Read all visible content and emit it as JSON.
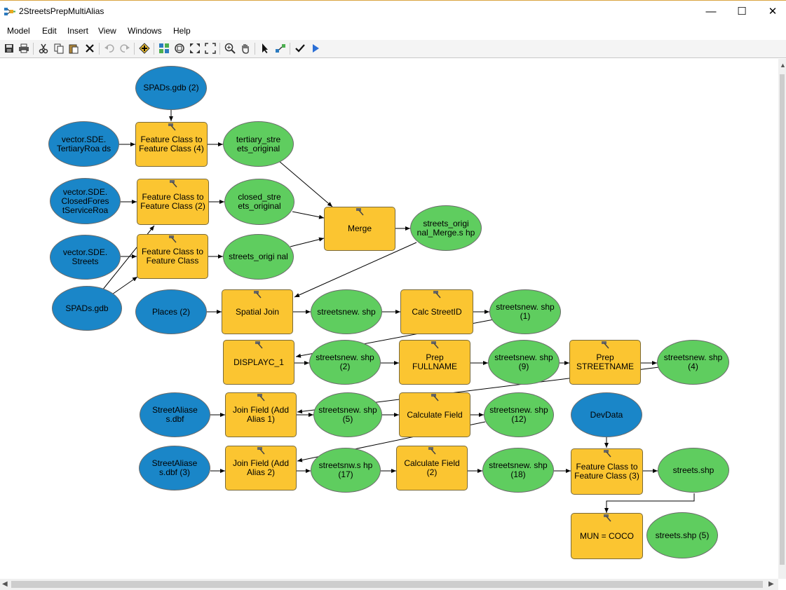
{
  "window": {
    "title": "2StreetsPrepMultiAlias",
    "minimize": "—",
    "maximize": "☐",
    "close": "✕"
  },
  "menu": [
    "Model",
    "Edit",
    "Insert",
    "View",
    "Windows",
    "Help"
  ],
  "toolbar": [
    "save-icon",
    "print-icon",
    "cut-icon",
    "copy-icon",
    "paste-icon",
    "delete-icon",
    "undo-icon",
    "redo-icon",
    "add-data-icon",
    "auto-layout-icon",
    "full-extent-icon",
    "zoom-in-fixed-icon",
    "zoom-full-icon",
    "zoom-in-icon",
    "pan-icon",
    "select-icon",
    "connect-icon",
    "validate-icon",
    "run-icon"
  ],
  "nodes": {
    "spads_gdb_2": "SPADs.gdb (2)",
    "fc_to_fc_4": "Feature Class to Feature Class (4)",
    "vector_tertiary": "vector.SDE. TertiaryRoa ds",
    "tertiary_streets_original": "tertiary_stre ets_original",
    "vector_closed": "vector.SDE. ClosedFores tServiceRoa",
    "fc_to_fc_2": "Feature Class to Feature Class (2)",
    "closed_streets_original": "closed_stre ets_original",
    "merge": "Merge",
    "streets_original_merge": "streets_origi nal_Merge.s hp",
    "vector_streets": "vector.SDE. Streets",
    "fc_to_fc": "Feature Class to Feature Class",
    "streets_original": "streets_origi nal",
    "spads_gdb": "SPADs.gdb",
    "places_2": "Places (2)",
    "spatial_join": "Spatial Join",
    "streetsnew_shp": "streetsnew. shp",
    "calc_streetid": "Calc StreetID",
    "streetsnew_shp_1": "streetsnew. shp (1)",
    "displayc_1": "DISPLAYC_1",
    "streetsnew_shp_2": "streetsnew. shp (2)",
    "prep_fullname": "Prep FULLNAME",
    "streetsnew_shp_9": "streetsnew. shp (9)",
    "prep_streetname": "Prep STREETNAME",
    "streetsnew_shp_4": "streetsnew. shp (4)",
    "streetaliases_dbf": "StreetAliase s.dbf",
    "join_field_1": "Join Field (Add Alias 1)",
    "streetsnew_shp_5": "streetsnew. shp (5)",
    "calculate_field": "Calculate Field",
    "streetsnew_shp_12": "streetsnew. shp (12)",
    "devdata": "DevData",
    "streetaliases_dbf_3": "StreetAliase s.dbf (3)",
    "join_field_2": "Join Field (Add Alias 2)",
    "streetsnw_shp_17": "streetsnw.s hp (17)",
    "calculate_field_2": "Calculate Field (2)",
    "streetsnew_shp_18": "streetsnew. shp (18)",
    "fc_to_fc_3": "Feature Class to Feature Class (3)",
    "streets_shp": "streets.shp",
    "mun_coco": "MUN = COCO",
    "streets_shp_5": "streets.shp (5)"
  },
  "colors": {
    "input": "#1a86c8",
    "derived": "#5fcd5f",
    "tool": "#fbc531"
  }
}
